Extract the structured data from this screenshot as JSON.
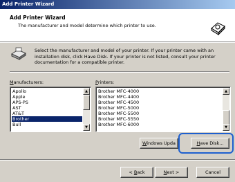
{
  "window": {
    "title": "Add Printer Wizard"
  },
  "header": {
    "title": "Add Printer Wizard",
    "subtitle": "The manufacturer and model determine which printer to use."
  },
  "instructions": "Select the manufacturer and model of your printer. If your printer came with an installation disk, click Have Disk. If your printer is not listed, consult your printer documentation for a compatible printer.",
  "manufacturers": {
    "label_key": "M",
    "label_rest": "anufacturers:",
    "items": [
      "Apollo",
      "Apple",
      "APS-PS",
      "AST",
      "AT&T",
      "Brother",
      "Bull"
    ],
    "selected": "Brother"
  },
  "printers": {
    "label_key": "P",
    "label_rest": "rinters:",
    "items": [
      "Brother MFC-4000",
      "Brother MFC-4400",
      "Brother MFC-4500",
      "Brother MFC-5000",
      "Brother MFC-5500",
      "Brother MFC-5550",
      "Brother MFC-6000"
    ]
  },
  "buttons": {
    "windows_update_key": "W",
    "windows_update_rest": "indows Upda",
    "have_disk_key": "H",
    "have_disk_rest": "ave Disk...",
    "back_key": "B",
    "back": "< ",
    "back_rest": "ack",
    "next_key": "N",
    "next_rest": "ext >",
    "cancel": "Cancel"
  },
  "colors": {
    "title_bar": "#0a246a",
    "selection": "#0a246a",
    "focus_ring": "#1d5fcf",
    "face": "#d4d0c8"
  }
}
